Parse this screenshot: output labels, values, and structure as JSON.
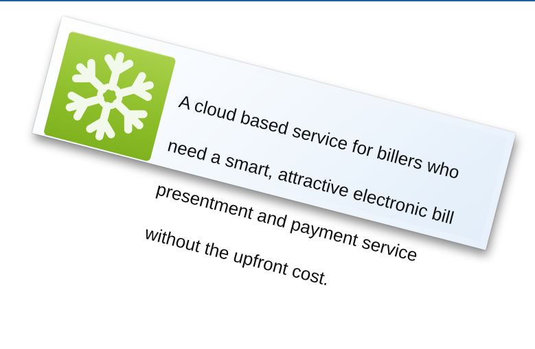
{
  "card": {
    "lines": [
      "A cloud based service for billers who",
      "need a smart, attractive electronic bill",
      "presentment and payment service",
      "without the upfront cost."
    ],
    "icon": "snowflake-icon"
  },
  "colors": {
    "accent_bar": "#1f5fa8",
    "icon_tile": "#8fc02c",
    "snowflake": "#ffffff"
  }
}
